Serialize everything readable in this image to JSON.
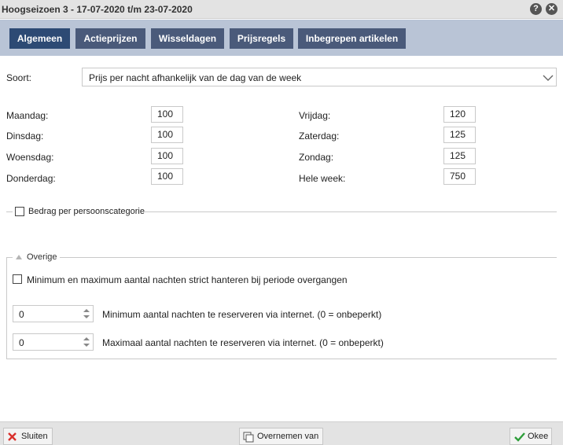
{
  "window": {
    "title": "Hoogseizoen 3 - 17-07-2020 t/m 23-07-2020"
  },
  "tabs": [
    {
      "label": "Algemeen",
      "active": true
    },
    {
      "label": "Actieprijzen"
    },
    {
      "label": "Wisseldagen"
    },
    {
      "label": "Prijsregels"
    },
    {
      "label": "Inbegrepen artikelen"
    }
  ],
  "soort": {
    "label": "Soort:",
    "value": "Prijs per nacht afhankelijk van de dag van de week"
  },
  "days": {
    "maandag": {
      "label": "Maandag:",
      "value": "100"
    },
    "dinsdag": {
      "label": "Dinsdag:",
      "value": "100"
    },
    "woensdag": {
      "label": "Woensdag:",
      "value": "100"
    },
    "donderdag": {
      "label": "Donderdag:",
      "value": "100"
    },
    "vrijdag": {
      "label": "Vrijdag:",
      "value": "120"
    },
    "zaterdag": {
      "label": "Zaterdag:",
      "value": "125"
    },
    "zondag": {
      "label": "Zondag:",
      "value": "125"
    },
    "hele_week": {
      "label": "Hele week:",
      "value": "750"
    }
  },
  "persoonscategorie": {
    "label": "Bedrag per persoonscategorie",
    "checked": false
  },
  "overige": {
    "legend": "Overige",
    "strict": {
      "label": "Minimum en maximum aantal nachten strict hanteren bij periode overgangen",
      "checked": false
    },
    "min_nights": {
      "value": "0",
      "label": "Minimum aantal nachten te reserveren via internet. (0 = onbeperkt)"
    },
    "max_nights": {
      "value": "0",
      "label": "Maximaal aantal nachten te reserveren via internet. (0 = onbeperkt)"
    }
  },
  "footer": {
    "close_label": "Sluiten",
    "copy_label": "Overnemen van",
    "ok_label": "Okee"
  },
  "colors": {
    "tab_active": "#2d4a74",
    "tab": "#4a5a7a",
    "tabbar": "#b9c4d6",
    "close_icon": "#d9302c",
    "ok_icon": "#2e9e3a"
  }
}
